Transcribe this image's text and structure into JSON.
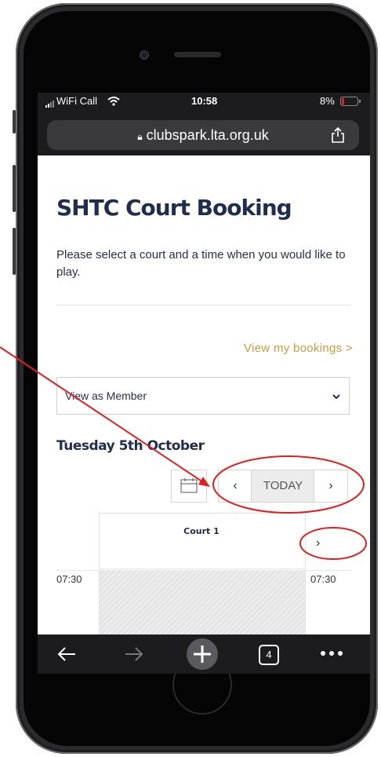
{
  "status_bar": {
    "carrier": "WiFi Call",
    "time": "10:58",
    "battery": "8%"
  },
  "browser": {
    "url": "clubspark.lta.org.uk",
    "tab_count": "4"
  },
  "page": {
    "title": "SHTC Court Booking",
    "subtitle": "Please select a court and a time when you would like to play.",
    "my_bookings_link": "View my bookings >",
    "member_select": {
      "value": "View as Member"
    },
    "date_heading": "Tuesday 5th October",
    "nav": {
      "prev": "‹",
      "today": "TODAY",
      "next": "›"
    },
    "court": {
      "name": "Court 1",
      "next": "›"
    },
    "times": [
      "07:30",
      "07:30"
    ]
  },
  "annotations": {
    "arrow_color": "#e02020",
    "circle_color": "#e02020"
  }
}
